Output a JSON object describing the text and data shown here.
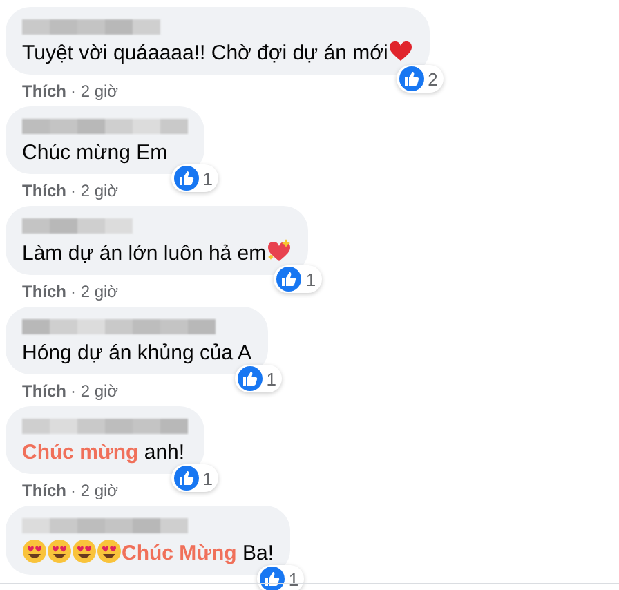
{
  "comments": [
    {
      "text": "Tuyệt vời quáaaaa!! Chờ đợi dự án mới",
      "end_icon": {
        "kind": "heart"
      },
      "like_label": "Thích",
      "time": "· 2 giờ",
      "reaction_count": "2"
    },
    {
      "text": "Chúc mừng Em",
      "like_label": "Thích",
      "time": "· 2 giờ",
      "reaction_count": "1"
    },
    {
      "text": "Làm dự án lớn luôn hả em",
      "end_icon": {
        "kind": "sparkling-heart"
      },
      "like_label": "Thích",
      "time": "· 2 giờ",
      "reaction_count": "1"
    },
    {
      "text": "Hóng dự án khủng của A",
      "like_label": "Thích",
      "time": "· 2 giờ",
      "reaction_count": "1"
    },
    {
      "text": "**Chúc mừng** anh!",
      "like_label": "Thích",
      "time": "· 2 giờ",
      "reaction_count": "1"
    },
    {
      "text": "**Chúc Mừng** Ba!",
      "start_icons": [
        {
          "kind": "heart-eyes"
        },
        {
          "kind": "heart-eyes"
        },
        {
          "kind": "heart-eyes"
        },
        {
          "kind": "heart-eyes"
        }
      ],
      "reaction_count": "1"
    }
  ]
}
